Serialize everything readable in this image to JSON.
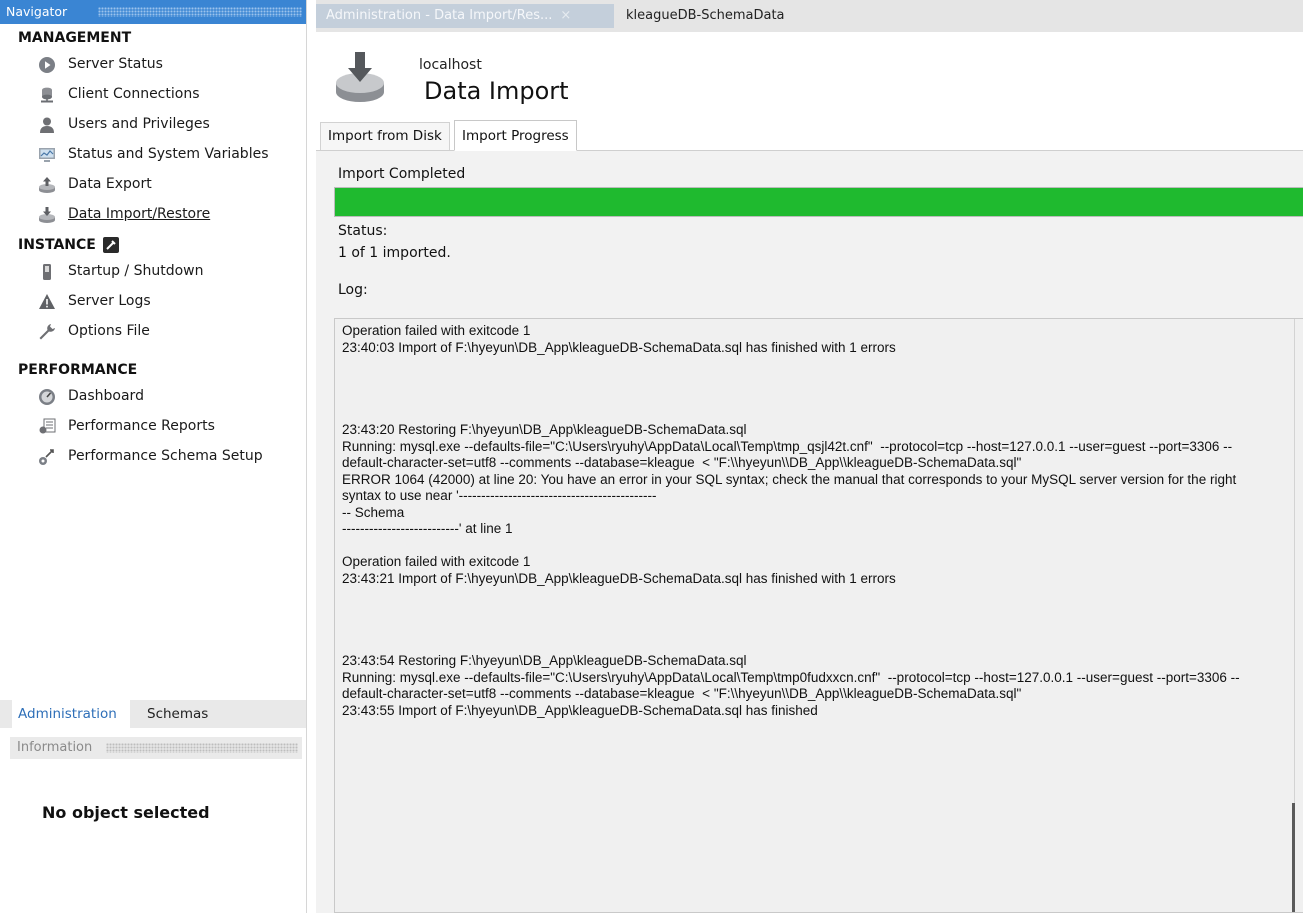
{
  "navigator": {
    "title": "Navigator",
    "sections": {
      "management": {
        "title": "MANAGEMENT",
        "items": [
          {
            "label": "Server Status",
            "icon": "play-circle-icon"
          },
          {
            "label": "Client Connections",
            "icon": "connections-icon"
          },
          {
            "label": "Users and Privileges",
            "icon": "user-icon"
          },
          {
            "label": "Status and System Variables",
            "icon": "monitor-icon"
          },
          {
            "label": "Data Export",
            "icon": "export-icon"
          },
          {
            "label": "Data Import/Restore",
            "icon": "import-icon"
          }
        ]
      },
      "instance": {
        "title": "INSTANCE",
        "items": [
          {
            "label": "Startup / Shutdown",
            "icon": "power-switch-icon"
          },
          {
            "label": "Server Logs",
            "icon": "warning-icon"
          },
          {
            "label": "Options File",
            "icon": "wrench-icon"
          }
        ]
      },
      "performance": {
        "title": "PERFORMANCE",
        "items": [
          {
            "label": "Dashboard",
            "icon": "gauge-icon"
          },
          {
            "label": "Performance Reports",
            "icon": "reports-icon"
          },
          {
            "label": "Performance Schema Setup",
            "icon": "schema-setup-icon"
          }
        ]
      }
    },
    "bottom_tabs": {
      "administration": "Administration",
      "schemas": "Schemas"
    },
    "information": {
      "title": "Information",
      "empty_text": "No object selected"
    }
  },
  "tabs": {
    "admin_tab": "Administration - Data Import/Res...",
    "close_glyph": "×",
    "schema_tab": "kleagueDB-SchemaData"
  },
  "header": {
    "host": "localhost",
    "title": "Data Import"
  },
  "subtabs": {
    "disk": "Import from Disk",
    "progress": "Import Progress"
  },
  "progress": {
    "label": "Import Completed",
    "percent": 100,
    "color": "#1fba2f"
  },
  "status": {
    "label": "Status:",
    "value": "1 of 1 imported."
  },
  "log": {
    "label": "Log:",
    "lines": [
      "Operation failed with exitcode 1",
      "23:40:03 Import of F:\\hyeyun\\DB_App\\kleagueDB-SchemaData.sql has finished with 1 errors",
      "",
      "",
      "",
      "",
      "23:43:20 Restoring F:\\hyeyun\\DB_App\\kleagueDB-SchemaData.sql",
      "Running: mysql.exe --defaults-file=\"C:\\Users\\ryuhy\\AppData\\Local\\Temp\\tmp_qsjl42t.cnf\"  --protocol=tcp --host=127.0.0.1 --user=guest --port=3306 --default-character-set=utf8 --comments --database=kleague  < \"F:\\\\hyeyun\\\\DB_App\\\\kleagueDB-SchemaData.sql\"",
      "ERROR 1064 (42000) at line 20: You have an error in your SQL syntax; check the manual that corresponds to your MySQL server version for the right syntax to use near '--------------------------------------------",
      "-- Schema",
      "--------------------------' at line 1",
      "",
      "Operation failed with exitcode 1",
      "23:43:21 Import of F:\\hyeyun\\DB_App\\kleagueDB-SchemaData.sql has finished with 1 errors",
      "",
      "",
      "",
      "",
      "23:43:54 Restoring F:\\hyeyun\\DB_App\\kleagueDB-SchemaData.sql",
      "Running: mysql.exe --defaults-file=\"C:\\Users\\ryuhy\\AppData\\Local\\Temp\\tmp0fudxxcn.cnf\"  --protocol=tcp --host=127.0.0.1 --user=guest --port=3306 --default-character-set=utf8 --comments --database=kleague  < \"F:\\\\hyeyun\\\\DB_App\\\\kleagueDB-SchemaData.sql\"",
      "23:43:55 Import of F:\\hyeyun\\DB_App\\kleagueDB-SchemaData.sql has finished"
    ]
  }
}
